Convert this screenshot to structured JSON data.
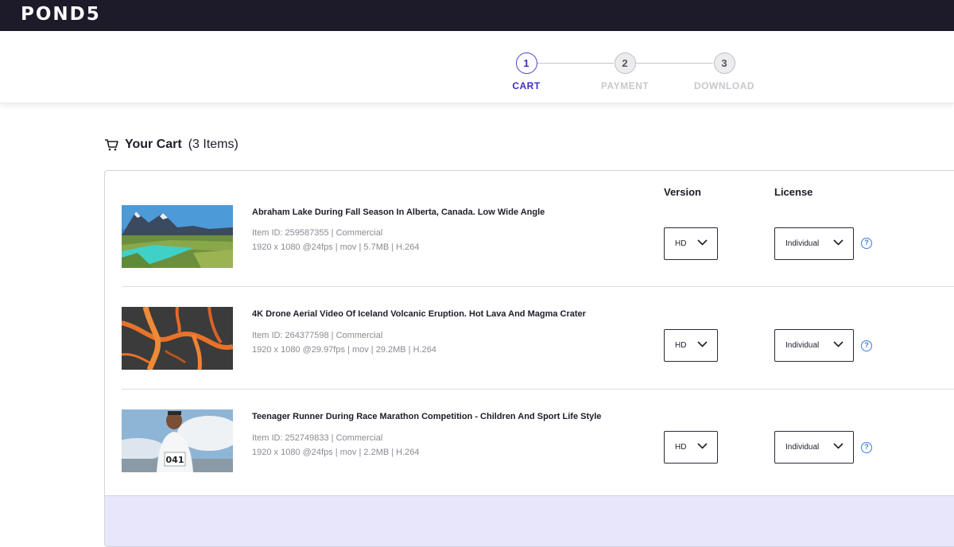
{
  "header": {
    "logo": "POND5"
  },
  "stepper": {
    "steps": [
      {
        "number": "1",
        "label": "CART",
        "active": true
      },
      {
        "number": "2",
        "label": "PAYMENT",
        "active": false
      },
      {
        "number": "3",
        "label": "DOWNLOAD",
        "active": false
      }
    ]
  },
  "cart": {
    "title": "Your Cart",
    "count": "(3 Items)",
    "columns": {
      "version": "Version",
      "license": "License"
    },
    "items": [
      {
        "title": "Abraham Lake During Fall Season In Alberta, Canada. Low Wide Angle",
        "item_id": "Item ID: 259587355 | Commercial",
        "specs": "1920 x 1080 @24fps | mov | 5.7MB | H.264",
        "version": "HD",
        "license": "Individual"
      },
      {
        "title": "4K Drone Aerial Video Of Iceland Volcanic Eruption. Hot Lava And Magma Crater",
        "item_id": "Item ID: 264377598 | Commercial",
        "specs": "1920 x 1080 @29.97fps | mov | 29.2MB | H.264",
        "version": "HD",
        "license": "Individual"
      },
      {
        "title": "Teenager Runner During Race Marathon Competition - Children And Sport Life Style",
        "item_id": "Item ID: 252749833 | Commercial",
        "specs": "1920 x 1080 @24fps | mov | 2.2MB | H.264",
        "version": "HD",
        "license": "Individual",
        "bib_number": "041"
      }
    ]
  },
  "help_glyph": "?",
  "colors": {
    "accent": "#3b2fc4",
    "topbar": "#1d1a2a",
    "footer_band": "#e7e6fb",
    "help": "#3a7be0"
  }
}
